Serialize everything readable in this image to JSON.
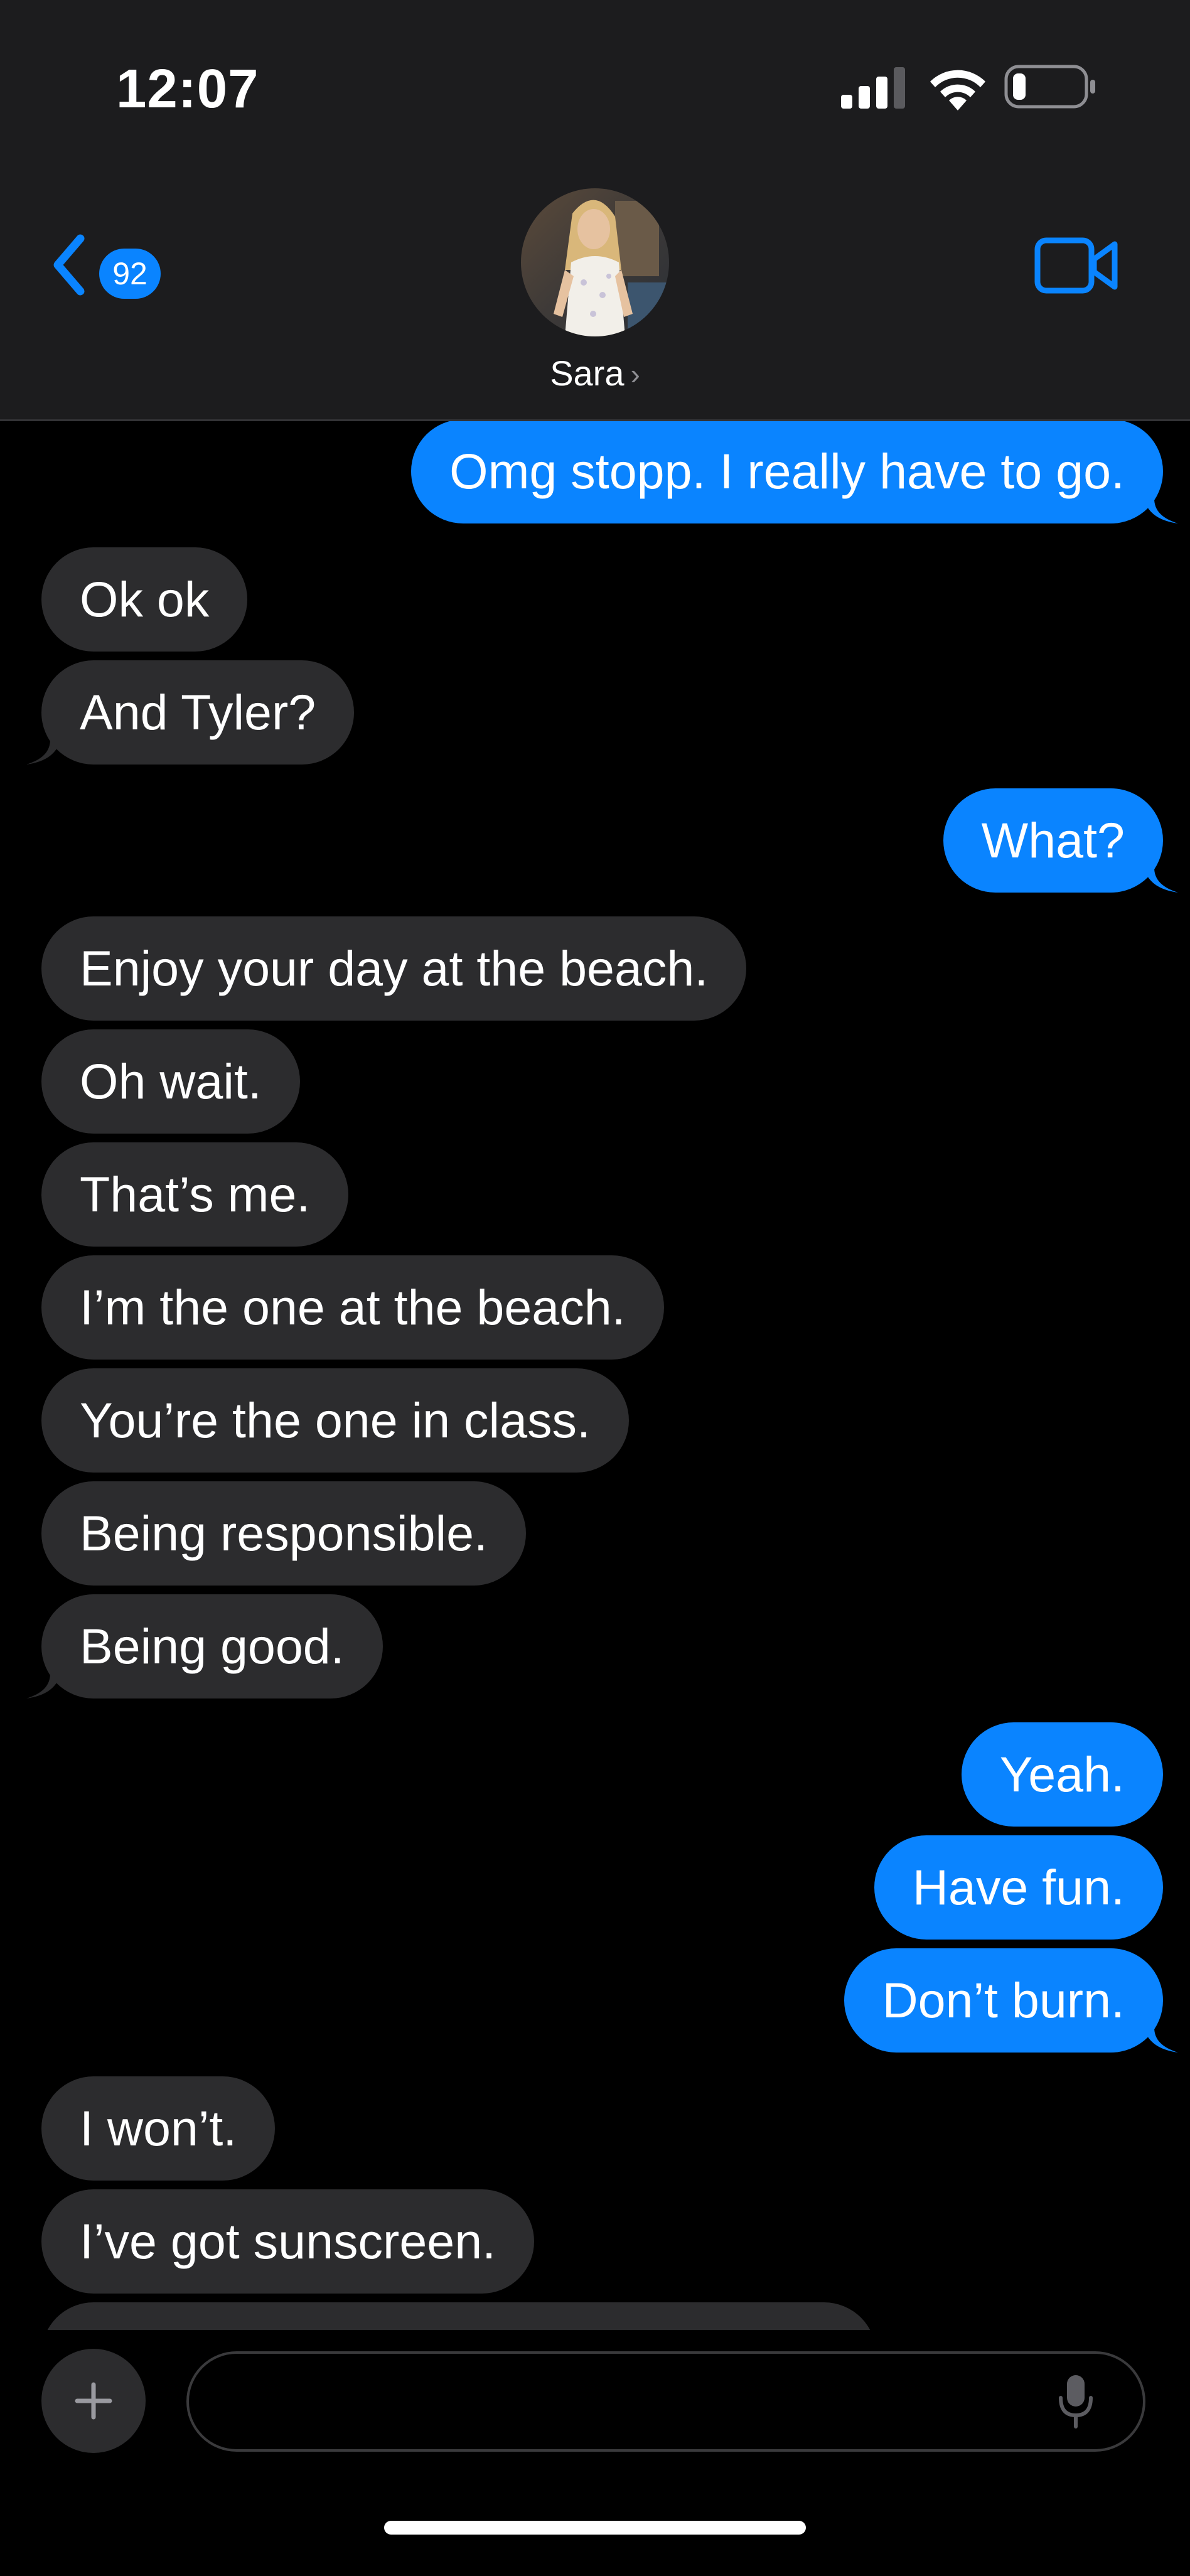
{
  "status_bar": {
    "time": "12:07"
  },
  "header": {
    "back_badge_count": "92",
    "contact_name": "Sara",
    "contact_chevron": "›",
    "icons": {
      "back": "chevron-left-icon",
      "video": "video-camera-icon"
    }
  },
  "messages": [
    {
      "side": "sent",
      "text": "Omg stopp. I really have to go."
    },
    {
      "side": "received",
      "text": "Ok ok"
    },
    {
      "side": "received",
      "text": "And Tyler?"
    },
    {
      "side": "sent",
      "text": "What?"
    },
    {
      "side": "received",
      "text": "Enjoy your day at the beach."
    },
    {
      "side": "received",
      "text": "Oh wait."
    },
    {
      "side": "received",
      "text": "That’s me."
    },
    {
      "side": "received",
      "text": "I’m the one at the beach."
    },
    {
      "side": "received",
      "text": "You’re the one in class."
    },
    {
      "side": "received",
      "text": "Being responsible."
    },
    {
      "side": "received",
      "text": "Being good."
    },
    {
      "side": "sent",
      "text": "Yeah."
    },
    {
      "side": "sent",
      "text": "Have fun."
    },
    {
      "side": "sent",
      "text": "Don’t burn."
    },
    {
      "side": "received",
      "text": "I won’t."
    },
    {
      "side": "received",
      "text": "I’ve got sunscreen."
    }
  ],
  "composer": {
    "placeholder": "",
    "icons": {
      "add": "plus-icon",
      "dictation": "microphone-icon"
    }
  },
  "colors": {
    "sent_bubble": "#0a84ff",
    "received_bubble": "#2c2c2e",
    "header_bg": "#1c1c1e",
    "background": "#000000"
  }
}
